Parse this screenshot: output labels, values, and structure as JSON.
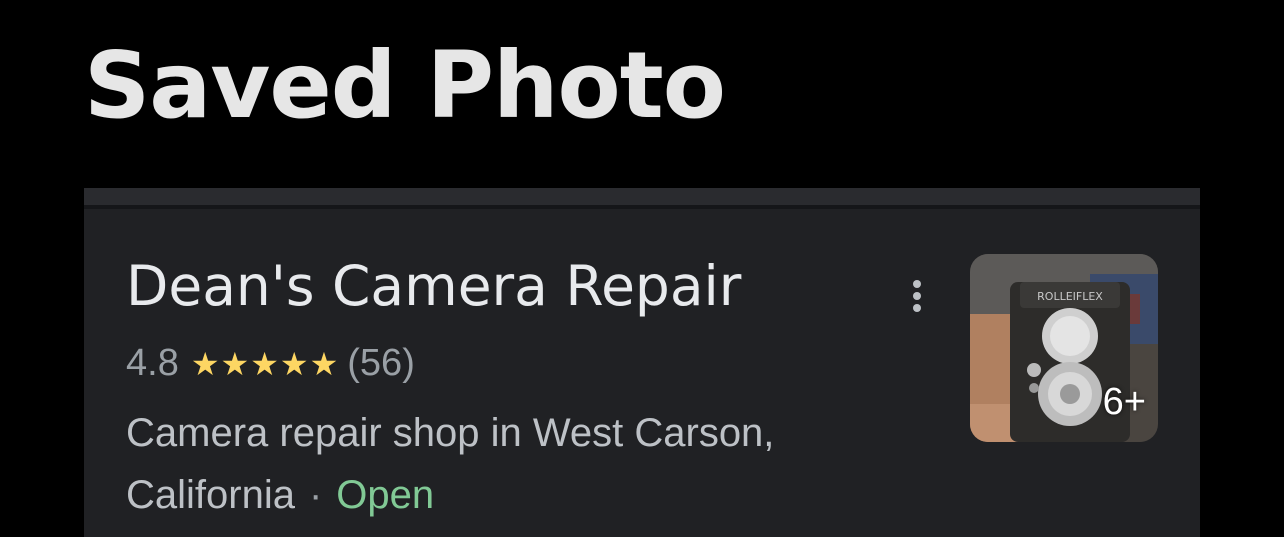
{
  "header": {
    "title": "Saved Photo"
  },
  "place": {
    "name": "Dean's Camera Repair",
    "rating": "4.8",
    "stars": "★★★★★",
    "reviews": "(56)",
    "description": "Camera repair shop in West Carson, California",
    "separator": "·",
    "status": "Open",
    "photo_count": "6+",
    "camera_brand": "ROLLEIFLEX"
  },
  "colors": {
    "background": "#000000",
    "card": "#202124",
    "star": "#fdd663",
    "open_status": "#81c995"
  },
  "icons": {
    "more": "more-vert-icon",
    "star": "star-icon"
  }
}
